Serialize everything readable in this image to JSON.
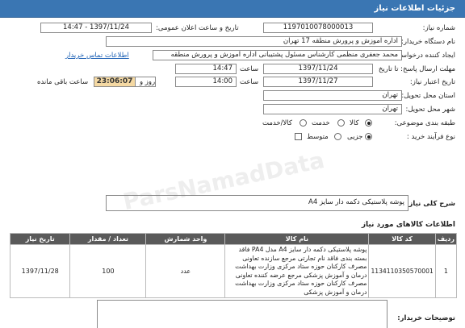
{
  "header": {
    "title": "جزئیات اطلاعات نیاز"
  },
  "need_number": {
    "label": "شماره نیاز:",
    "value": "1197010078000013"
  },
  "announce_datetime": {
    "label": "تاریخ و ساعت اعلان عمومی:",
    "value": "1397/11/24 - 14:47"
  },
  "buyer_org": {
    "label": "نام دستگاه خریدار:",
    "value": "اداره آموزش و پرورش منطقه 17 تهران"
  },
  "requester": {
    "label": "ایجاد کننده درخواست:",
    "value": "محمد جعفری منظمی کارشناس مسئول پشتیبانی اداره آموزش و پرورش منطقه",
    "contact_link": "اطلاعات تماس خریدار"
  },
  "reply_deadline": {
    "label": "مهلت ارسال پاسخ: تا تاریخ",
    "date": "1397/11/24",
    "time_label": "ساعت",
    "time": "14:47"
  },
  "validity": {
    "label": "تاریخ اعتبار نیاز:",
    "date": "1397/11/27",
    "time_label": "ساعت",
    "time": "14:00",
    "days": "2",
    "days_label": "روز و",
    "remaining": "23:06:07",
    "remaining_label": "ساعت باقی مانده"
  },
  "province": {
    "label": "استان محل تحویل:",
    "value": "تهران"
  },
  "city": {
    "label": "شهر محل تحویل:",
    "value": "تهران"
  },
  "category": {
    "label": "طبقه بندی موضوعی:",
    "options": [
      "کالا",
      "خدمت",
      "کالا/خدمت"
    ],
    "selected": "کالا"
  },
  "process_type": {
    "label": "نوع فرآیند خرید :",
    "options": [
      "جزیی",
      "متوسط"
    ],
    "selected": "جزیی"
  },
  "general_desc": {
    "label": "شرح کلی نیاز:",
    "value": "پوشه پلاستیکی دکمه دار سایز A4"
  },
  "goods_section": {
    "title": "اطلاعات کالاهای مورد نیاز"
  },
  "watermark": {
    "text": "ParsNamadData"
  },
  "table": {
    "headers": [
      "ردیف",
      "کد کالا",
      "نام کالا",
      "واحد شمارش",
      "تعداد / مقدار",
      "تاریخ نیاز"
    ],
    "rows": [
      {
        "row": "1",
        "code": "1134110350570001",
        "name": "پوشه پلاستیکی دکمه دار سایز A4 مدل PA4 فاقد بسته بندی فاقد نام تجارتی مرجع سازنده تعاونی مصرف کارکنان حوزه ستاد مرکزی وزارت بهداشت درمان و آموزش پزشکی مرجع عرضه کننده تعاونی مصرف کارکنان حوزه ستاد مرکزی وزارت بهداشت درمان و آموزش پزشکی",
        "unit": "عدد",
        "qty": "100",
        "date": "1397/11/28"
      }
    ]
  },
  "buyer_notes": {
    "label": "توضیحات خریدار:"
  }
}
